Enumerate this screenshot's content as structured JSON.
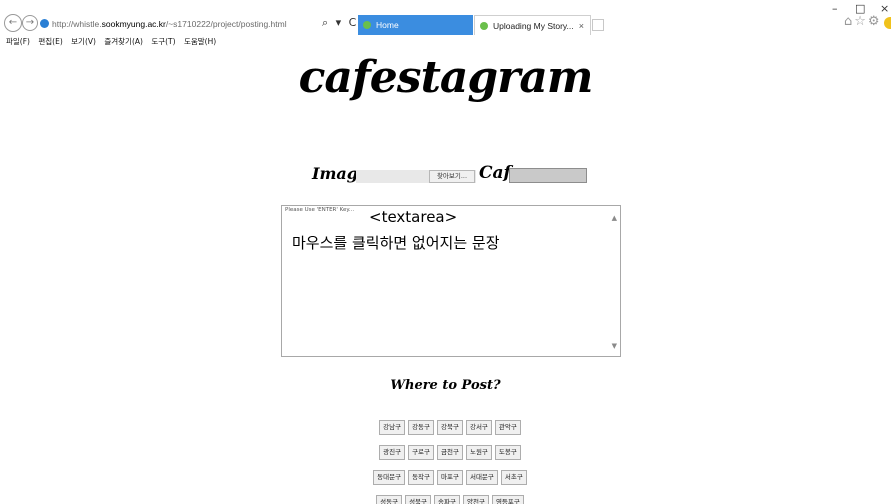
{
  "browser": {
    "address_prefix": "http://whistle.",
    "address_domain": "sookmyung.ac.kr",
    "address_path": "/~s1710222/project/posting.html",
    "address_tools": "⌕ ▾ C",
    "tabs": [
      {
        "label": "Home"
      },
      {
        "label": "Uploading My Story..."
      }
    ],
    "tab_close": "×",
    "window": {
      "minimize": "–",
      "maximize": "□",
      "close": "×"
    },
    "toolbar_icons": "⌂☆⚙",
    "menu": [
      "파일(F)",
      "편집(E)",
      "보기(V)",
      "즐겨찾기(A)",
      "도구(T)",
      "도움말(H)"
    ]
  },
  "page": {
    "logo": "cafestagram",
    "image_label": "Image",
    "file_button": "찾아보기...",
    "cafe_label": "Cafe",
    "cafe_value": "",
    "textarea": {
      "placeholder": "Please Use 'ENTER' Key...",
      "tag": "<textarea>",
      "message": "마우스를 클릭하면 없어지는 문장"
    },
    "where_to_post": "Where to Post?",
    "districts": [
      [
        "강남구",
        "강동구",
        "강북구",
        "강서구",
        "관악구"
      ],
      [
        "광진구",
        "구로구",
        "금천구",
        "노원구",
        "도봉구"
      ],
      [
        "동대문구",
        "동작구",
        "마포구",
        "서대문구",
        "서초구"
      ],
      [
        "성동구",
        "성북구",
        "송파구",
        "양천구",
        "영등포구"
      ]
    ]
  }
}
